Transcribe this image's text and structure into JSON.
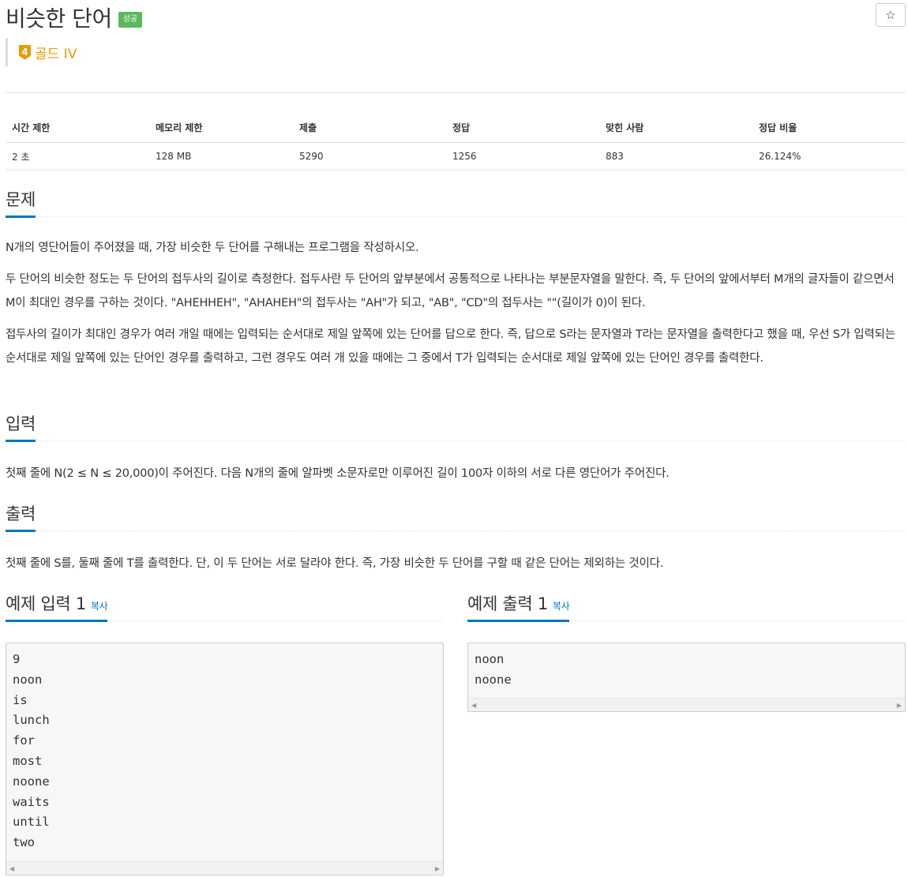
{
  "problem": {
    "title": "비슷한 단어",
    "status_badge": "성공",
    "star_icon": "☆",
    "tier_number": "4",
    "tier_label": "골드 IV"
  },
  "info": {
    "headers": [
      "시간 제한",
      "메모리 제한",
      "제출",
      "정답",
      "맞힌 사람",
      "정답 비율"
    ],
    "values": [
      "2 초",
      "128 MB",
      "5290",
      "1256",
      "883",
      "26.124%"
    ]
  },
  "sections": {
    "description": {
      "title": "문제",
      "paragraphs": [
        "N개의 영단어들이 주어졌을 때, 가장 비슷한 두 단어를 구해내는 프로그램을 작성하시오.",
        "두 단어의 비슷한 정도는 두 단어의 접두사의 길이로 측정한다. 접두사란 두 단어의 앞부분에서 공통적으로 나타나는 부분문자열을 말한다. 즉, 두 단어의 앞에서부터 M개의 글자들이 같으면서 M이 최대인 경우를 구하는 것이다. \"AHEHHEH\", \"AHAHEH\"의 접두사는 \"AH\"가 되고, \"AB\", \"CD\"의 접두사는 \"\"(길이가 0)이 된다.",
        "접두사의 길이가 최대인 경우가 여러 개일 때에는 입력되는 순서대로 제일 앞쪽에 있는 단어를 답으로 한다. 즉, 답으로 S라는 문자열과 T라는 문자열을 출력한다고 했을 때, 우선 S가 입력되는 순서대로 제일 앞쪽에 있는 단어인 경우를 출력하고, 그런 경우도 여러 개 있을 때에는 그 중에서 T가 입력되는 순서대로 제일 앞쪽에 있는 단어인 경우를 출력한다."
      ]
    },
    "input": {
      "title": "입력",
      "text": "첫째 줄에 N(2 ≤ N ≤ 20,000)이 주어진다. 다음 N개의 줄에 알파벳 소문자로만 이루어진 길이 100자 이하의 서로 다른 영단어가 주어진다."
    },
    "output": {
      "title": "출력",
      "text": "첫째 줄에 S를, 둘째 줄에 T를 출력한다. 단, 이 두 단어는 서로 달라야 한다. 즉, 가장 비슷한 두 단어를 구할 때 같은 단어는 제외하는 것이다."
    }
  },
  "samples": {
    "input": {
      "title": "예제 입력 1",
      "copy_label": "복사",
      "content": "9\nnoon\nis\nlunch\nfor\nmost\nnoone\nwaits\nuntil\ntwo"
    },
    "output": {
      "title": "예제 출력 1",
      "copy_label": "복사",
      "content": "noon\nnoone"
    },
    "scroll_left": "◀",
    "scroll_right": "▶"
  }
}
